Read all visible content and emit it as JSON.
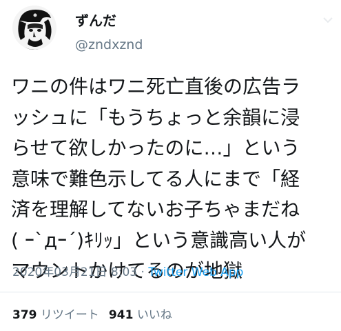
{
  "user": {
    "display_name": "ずんだ",
    "handle": "@zndxznd"
  },
  "tweet": {
    "lines": [
      "ワニの件はワニ死亡直後の広告ラ",
      "ッシュに「もうちょっと余韻に浸",
      "らせて欲しかったのに…」という",
      "意味で難色示してる人にまで「経",
      "済を理解してないお子ちゃまだね",
      "( ｰ`дｰ´)ｷﾘｯ」という意識高い人が",
      "マウントかけてるのが地獄"
    ],
    "timestamp": "2020年03月21日 8:03",
    "separator": " · ",
    "source": "Twitter Web App"
  },
  "stats": {
    "retweets_count": "379",
    "retweets_label": "リツイート",
    "likes_count": "941",
    "likes_label": "いいね"
  },
  "icons": {
    "avatar": "avatar-photo",
    "menu": "chevron-down-icon"
  },
  "colors": {
    "text": "#14171a",
    "secondary": "#657786",
    "link": "#1da1f2",
    "divider": "#e1e8ed"
  }
}
